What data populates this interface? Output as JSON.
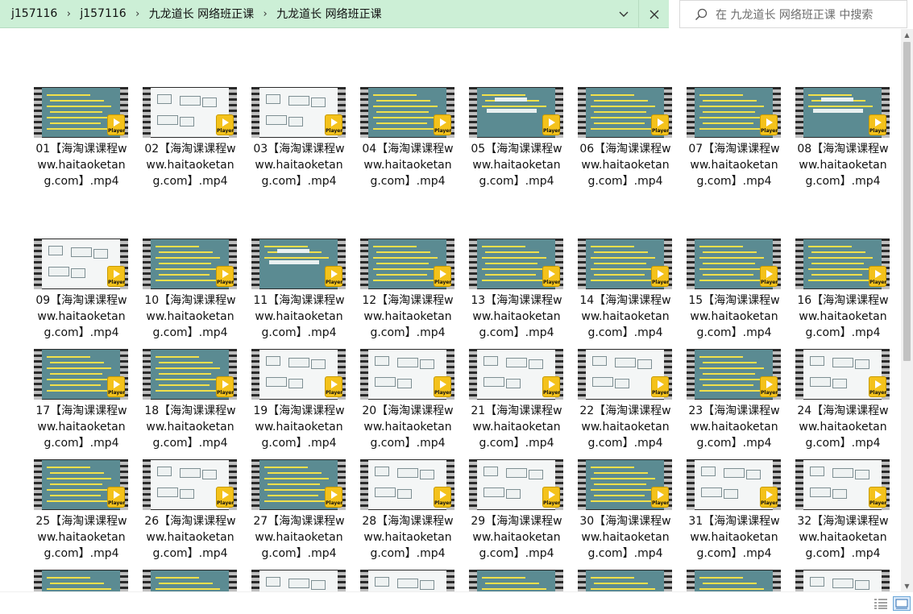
{
  "breadcrumb": [
    "j157116",
    "j157116",
    "九龙道长 网络班正课",
    "九龙道长 网络班正课"
  ],
  "search_placeholder": "在 九龙道长 网络班正课 中搜索",
  "player_badge": "Player",
  "files": [
    "01【海淘课课程www.haitaoketang.com】.mp4",
    "02【海淘课课程www.haitaoketang.com】.mp4",
    "03【海淘课课程www.haitaoketang.com】.mp4",
    "04【海淘课课程www.haitaoketang.com】.mp4",
    "05【海淘课课程www.haitaoketang.com】.mp4",
    "06【海淘课课程www.haitaoketang.com】.mp4",
    "07【海淘课课程www.haitaoketang.com】.mp4",
    "08【海淘课课程www.haitaoketang.com】.mp4",
    "09【海淘课课程www.haitaoketang.com】.mp4",
    "10【海淘课课程www.haitaoketang.com】.mp4",
    "11【海淘课课程www.haitaoketang.com】.mp4",
    "12【海淘课课程www.haitaoketang.com】.mp4",
    "13【海淘课课程www.haitaoketang.com】.mp4",
    "14【海淘课课程www.haitaoketang.com】.mp4",
    "15【海淘课课程www.haitaoketang.com】.mp4",
    "16【海淘课课程www.haitaoketang.com】.mp4",
    "17【海淘课课程www.haitaoketang.com】.mp4",
    "18【海淘课课程www.haitaoketang.com】.mp4",
    "19【海淘课课程www.haitaoketang.com】.mp4",
    "20【海淘课课程www.haitaoketang.com】.mp4",
    "21【海淘课课程www.haitaoketang.com】.mp4",
    "22【海淘课课程www.haitaoketang.com】.mp4",
    "23【海淘课课程www.haitaoketang.com】.mp4",
    "24【海淘课课程www.haitaoketang.com】.mp4",
    "25【海淘课课程www.haitaoketang.com】.mp4",
    "26【海淘课课程www.haitaoketang.com】.mp4",
    "27【海淘课课程www.haitaoketang.com】.mp4",
    "28【海淘课课程www.haitaoketang.com】.mp4",
    "29【海淘课课程www.haitaoketang.com】.mp4",
    "30【海淘课课程www.haitaoketang.com】.mp4",
    "31【海淘课课程www.haitaoketang.com】.mp4",
    "32【海淘课课程www.haitaoketang.com】.mp4",
    "",
    "",
    "",
    "",
    "",
    "",
    "",
    ""
  ],
  "colors": {
    "address_bar": "#ccefd6",
    "slide_teal": "#5b8b92",
    "slide_white": "#f4f6f6",
    "play_badge": "#f4c21b"
  },
  "icons": [
    "chevron-right-icon",
    "chevron-down-icon",
    "close-icon",
    "search-icon",
    "film-thumbnail-icon",
    "play-icon",
    "details-view-icon",
    "large-icons-view-icon"
  ]
}
